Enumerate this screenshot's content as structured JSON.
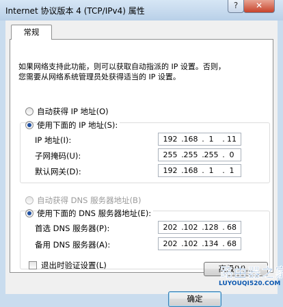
{
  "window": {
    "title": "Internet 协议版本 4 (TCP/IPv4) 属性",
    "help": "?",
    "close": "✕"
  },
  "tab": {
    "label": "常规"
  },
  "description": [
    "如果网络支持此功能，则可以获取自动指派的 IP 设置。否则，",
    "您需要从网络系统管理员处获得适当的 IP 设置。"
  ],
  "ip": {
    "auto_label": "自动获得 IP 地址(O)",
    "manual_label": "使用下面的 IP 地址(S):",
    "selected": "manual",
    "fields": [
      {
        "label": "IP 地址(I):",
        "octets": [
          "192",
          "168",
          "1",
          "11"
        ]
      },
      {
        "label": "子网掩码(U):",
        "octets": [
          "255",
          "255",
          "255",
          "0"
        ]
      },
      {
        "label": "默认网关(D):",
        "octets": [
          "192",
          "168",
          "1",
          "1"
        ]
      }
    ]
  },
  "dns": {
    "auto_label": "自动获得 DNS 服务器地址(B)",
    "manual_label": "使用下面的 DNS 服务器地址(E):",
    "selected": "manual",
    "fields": [
      {
        "label": "首选 DNS 服务器(P):",
        "octets": [
          "202",
          "102",
          "128",
          "68"
        ]
      },
      {
        "label": "备用 DNS 服务器(A):",
        "octets": [
          "202",
          "102",
          "134",
          "68"
        ]
      }
    ]
  },
  "validate": {
    "label": "退出时验证设置(L)",
    "checked": false
  },
  "buttons": {
    "advanced": "高级(V)...",
    "ok": "确定"
  },
  "watermark": {
    "main": "路由器之家",
    "sub": "LUYOUQI520.COM"
  },
  "colors": {
    "title_bar": "#b9d0e8",
    "close": "#c7432b",
    "radio_dot": "#1d4fa3",
    "watermark": "#0c58b0"
  }
}
